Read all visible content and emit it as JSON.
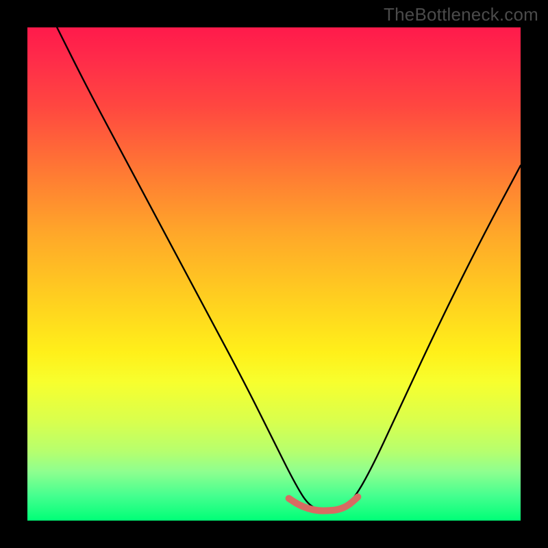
{
  "watermark": "TheBottleneck.com",
  "chart_data": {
    "type": "line",
    "title": "",
    "xlabel": "",
    "ylabel": "",
    "xlim": [
      0,
      100
    ],
    "ylim": [
      0,
      100
    ],
    "grid": false,
    "legend": false,
    "series": [
      {
        "name": "curve",
        "color": "#000000",
        "x": [
          6,
          12,
          20,
          28,
          36,
          44,
          50,
          54,
          57,
          60,
          63,
          66,
          70,
          76,
          84,
          92,
          100
        ],
        "y": [
          100,
          88,
          73,
          58,
          43,
          28,
          16,
          8,
          3,
          2,
          2,
          4,
          11,
          24,
          41,
          57,
          72
        ]
      },
      {
        "name": "bottom-highlight",
        "color": "#d86b62",
        "x": [
          53,
          55,
          57,
          59,
          61,
          63,
          65,
          67
        ],
        "y": [
          4.5,
          3.2,
          2.4,
          2.0,
          2.0,
          2.2,
          3.0,
          4.8
        ]
      }
    ],
    "colors": {
      "gradient_top": "#ff1a4b",
      "gradient_mid": "#ffd21f",
      "gradient_bottom": "#00ff77",
      "frame": "#000000",
      "highlight": "#d86b62"
    }
  }
}
